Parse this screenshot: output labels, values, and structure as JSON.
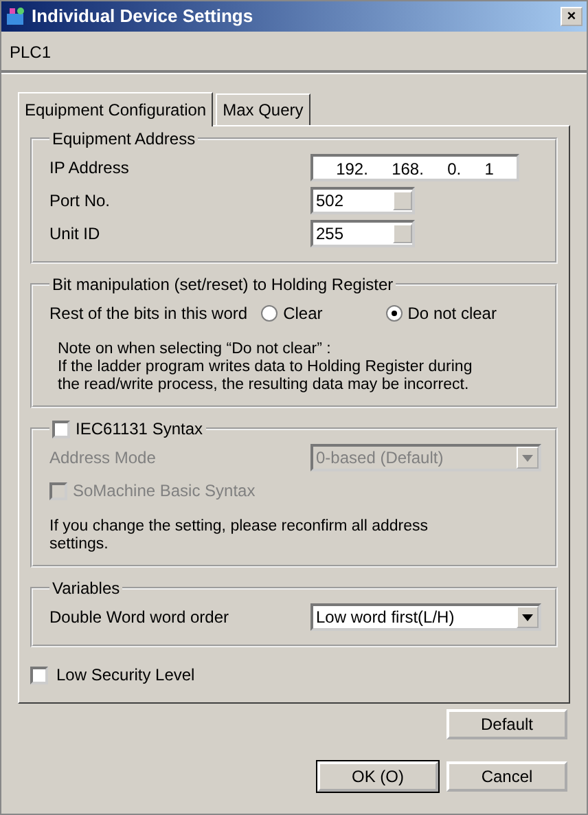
{
  "window": {
    "title": "Individual Device Settings",
    "close": "×"
  },
  "device": "PLC1",
  "tabs": [
    {
      "label": "Equipment Configuration",
      "selected": true
    },
    {
      "label": "Max Query",
      "selected": false
    }
  ],
  "equipment_address": {
    "title": "Equipment Address",
    "fields": [
      {
        "kind": "ip",
        "label": "IP Address",
        "octets": [
          "192.",
          "168.",
          "0.",
          "1"
        ]
      },
      {
        "kind": "spin",
        "label": "Port No.",
        "value": "502"
      },
      {
        "kind": "spin",
        "label": "Unit ID",
        "value": "255"
      }
    ]
  },
  "bit_manipulation": {
    "title": "Bit manipulation (set/reset) to Holding Register",
    "label": "Rest of the bits in this word",
    "options": [
      {
        "label": "Clear",
        "selected": false
      },
      {
        "label": "Do not clear",
        "selected": true
      }
    ],
    "note": "Note on when selecting “Do not clear” :\nIf the ladder program writes data to Holding Register during\nthe read/write process, the resulting data may be incorrect."
  },
  "iec": {
    "label": "IEC61131 Syntax",
    "checked": false,
    "address_mode": {
      "label": "Address Mode",
      "value": "0-based (Default)",
      "disabled": true
    },
    "somachine": {
      "label": "SoMachine Basic Syntax",
      "checked": false,
      "disabled": true
    },
    "note": "If you change the setting, please reconfirm all address\nsettings."
  },
  "variables": {
    "title": "Variables",
    "label": "Double Word word order",
    "value": "Low word first(L/H)"
  },
  "low_security": {
    "label": "Low Security Level",
    "checked": false
  },
  "buttons": [
    {
      "label": "Default",
      "kind": "side"
    },
    {
      "label": "OK (O)",
      "kind": "default"
    },
    {
      "label": "Cancel",
      "kind": "normal"
    }
  ]
}
